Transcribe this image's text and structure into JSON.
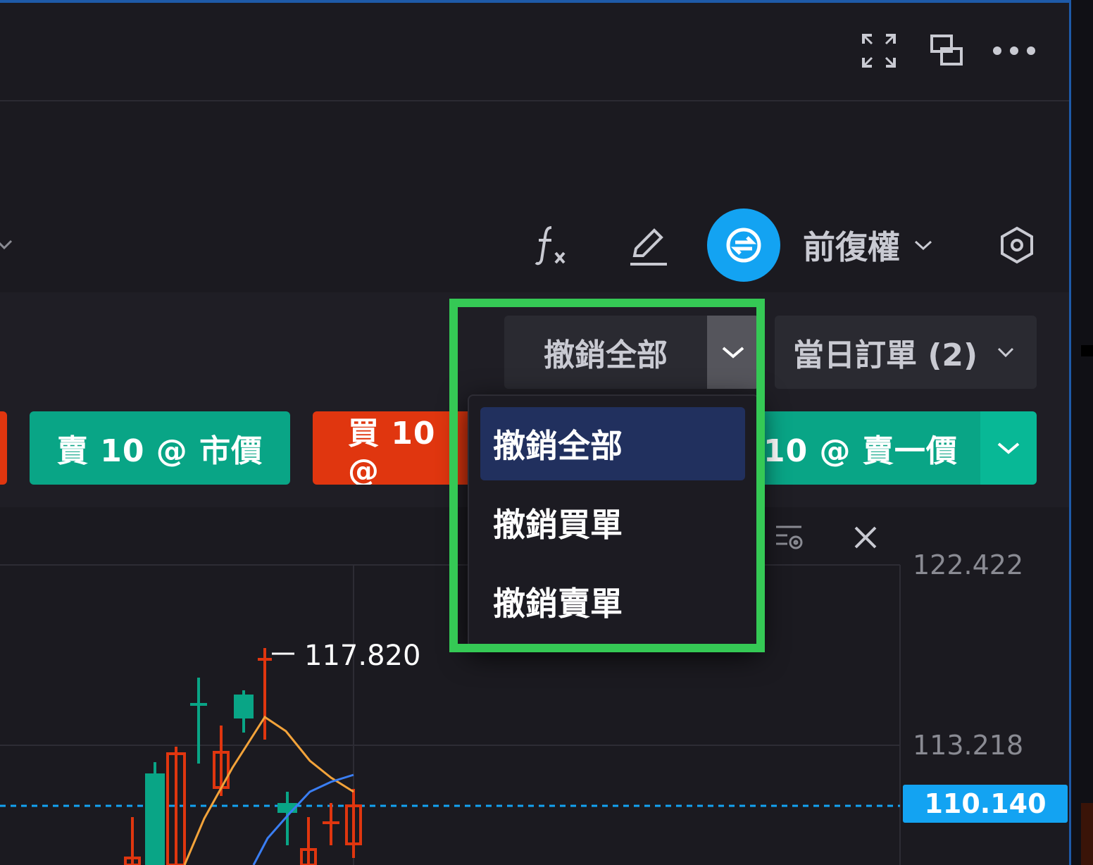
{
  "colors": {
    "background": "#1b1a20",
    "panel": "#1f1e25",
    "buy_red": "#e0360f",
    "sell_green": "#09a586",
    "accent_blue": "#13a3f2",
    "dropdown_selected": "#21305e",
    "highlight_green": "#35c955"
  },
  "header": {
    "icons": [
      "fullscreen-icon",
      "popout-window-icon",
      "more-icon"
    ]
  },
  "chart_toolbar": {
    "icons": [
      "indicator-fx-icon",
      "draw-pencil-icon",
      "swap-order-icon",
      "settings-hexagon-icon"
    ],
    "adjust_label": "前復權"
  },
  "orders": {
    "cancel_all_label": "撤銷全部",
    "today_orders_label": "當日訂單 (2)"
  },
  "trade_buttons": {
    "sell_market": "賣 10 @ 市價",
    "buy_market": "買 10 @",
    "sell_ask": "10 @ 賣一價"
  },
  "dropdown": {
    "items": [
      "撤銷全部",
      "撤銷買單",
      "撤銷賣單"
    ],
    "selected_index": 0
  },
  "chart": {
    "high_marker": "117.820",
    "axis_prices": [
      "122.422",
      "113.218"
    ],
    "current_price": "110.140"
  }
}
